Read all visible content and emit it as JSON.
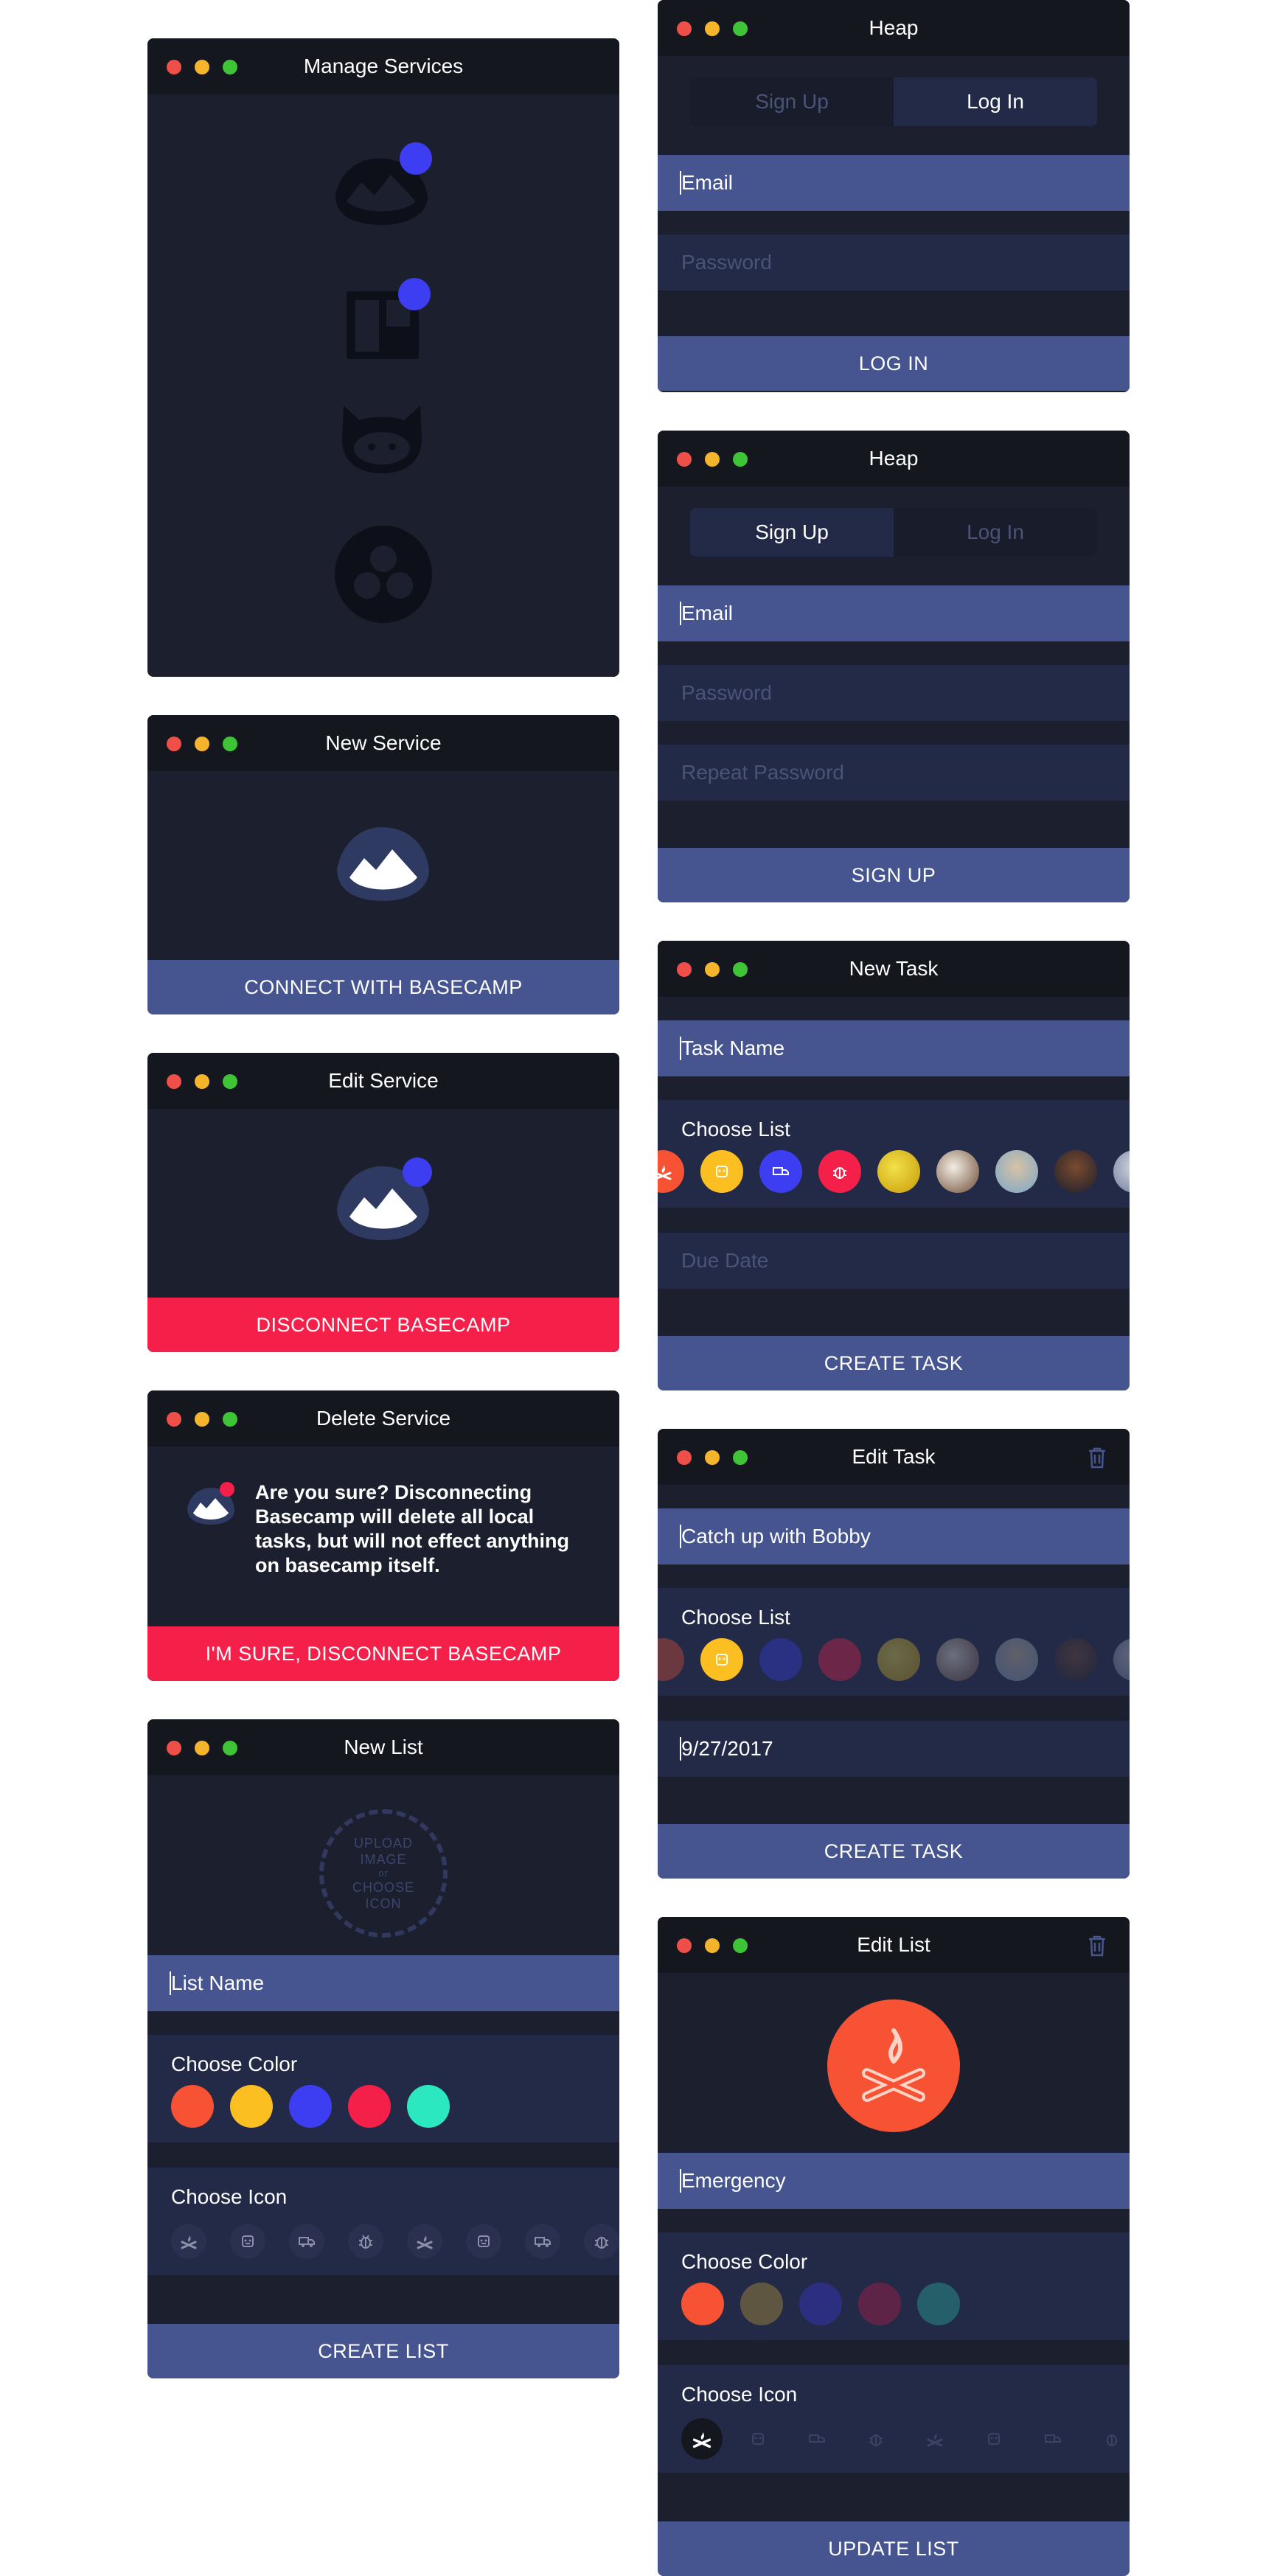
{
  "colors": {
    "window_bg": "#1c1f2e",
    "titlebar_bg": "#15171f",
    "field_bg": "#222a48",
    "active_field_bg": "#465590",
    "primary_button": "#465590",
    "danger_button": "#f5204a",
    "notification_dot": "#3d3ef2"
  },
  "manage_services": {
    "title": "Manage Services",
    "services": [
      "basecamp-icon",
      "trello-icon",
      "github-icon",
      "asana-icon"
    ]
  },
  "new_service": {
    "title": "New Service",
    "button": "CONNECT WITH BASECAMP"
  },
  "edit_service": {
    "title": "Edit Service",
    "button": "DISCONNECT BASECAMP"
  },
  "delete_service": {
    "title": "Delete Service",
    "message": "Are you sure? Disconnecting Basecamp will delete all local tasks, but will not effect anything on basecamp itself.",
    "button": "I'M SURE, DISCONNECT BASECAMP"
  },
  "new_list": {
    "title": "New List",
    "upload_line1": "UPLOAD",
    "upload_line2": "IMAGE",
    "upload_or": "or",
    "upload_line3": "CHOOSE",
    "upload_line4": "ICON",
    "name_placeholder": "List Name",
    "choose_color": "Choose Color",
    "colors": [
      "#f75233",
      "#fcbf22",
      "#3d3ef2",
      "#f5204a",
      "#2ce8c1"
    ],
    "choose_icon": "Choose Icon",
    "button": "CREATE LIST"
  },
  "heap_login": {
    "title": "Heap",
    "tab_signup": "Sign Up",
    "tab_login": "Log In",
    "email": "Email",
    "password": "Password",
    "button": "LOG IN"
  },
  "heap_signup": {
    "title": "Heap",
    "tab_signup": "Sign Up",
    "tab_login": "Log In",
    "email": "Email",
    "password": "Password",
    "repeat_password": "Repeat Password",
    "button": "SIGN UP"
  },
  "new_task": {
    "title": "New Task",
    "name_placeholder": "Task Name",
    "choose_list": "Choose List",
    "due_date": "Due Date",
    "button": "CREATE TASK"
  },
  "edit_task": {
    "title": "Edit Task",
    "name_value": "Catch up with Bobby",
    "choose_list": "Choose List",
    "date_value": "9/27/2017",
    "button": "CREATE TASK"
  },
  "edit_list": {
    "title": "Edit List",
    "name_value": "Emergency",
    "choose_color": "Choose Color",
    "colors": [
      "#f75233",
      "#fcbf22",
      "#3d3ef2",
      "#f5204a",
      "#2ce8c1"
    ],
    "choose_icon": "Choose Icon",
    "button": "UPDATE LIST"
  }
}
